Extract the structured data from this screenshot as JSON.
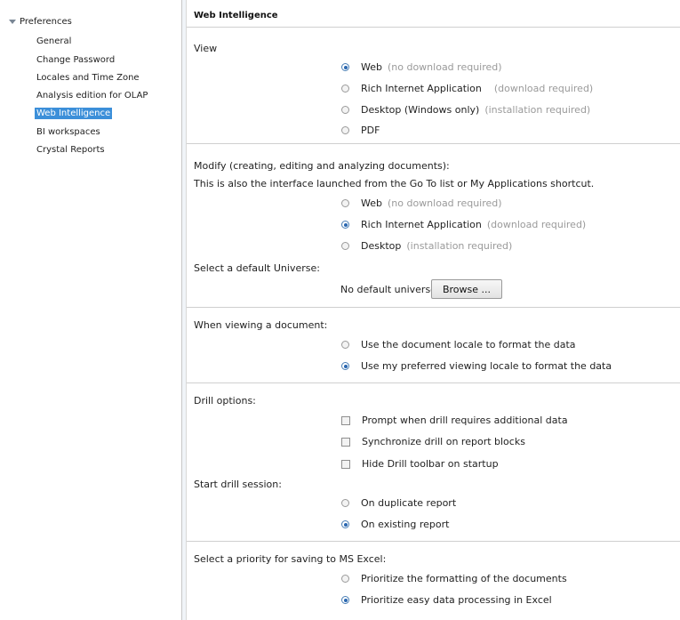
{
  "sidebar": {
    "root_label": "Preferences",
    "items": [
      {
        "label": "General"
      },
      {
        "label": "Change Password"
      },
      {
        "label": "Locales and Time Zone"
      },
      {
        "label": "Analysis edition for OLAP"
      },
      {
        "label": "Web Intelligence",
        "selected": true
      },
      {
        "label": "BI workspaces"
      },
      {
        "label": "Crystal Reports"
      }
    ]
  },
  "main": {
    "title": "Web Intelligence",
    "view": {
      "label": "View",
      "options": [
        {
          "label": "Web",
          "hint": "(no download required)",
          "selected": true
        },
        {
          "label": "Rich Internet Application",
          "hint": "(download required)",
          "selected": false
        },
        {
          "label": "Desktop (Windows only)",
          "hint": "(installation required)",
          "selected": false
        },
        {
          "label": "PDF",
          "hint": "",
          "selected": false
        }
      ]
    },
    "modify": {
      "label_line1": "Modify (creating, editing and analyzing documents):",
      "label_line2": "This is also the interface launched from the Go To list or My Applications shortcut.",
      "options": [
        {
          "label": "Web",
          "hint": "(no download required)",
          "selected": false
        },
        {
          "label": "Rich Internet Application",
          "hint": "(download required)",
          "selected": true
        },
        {
          "label": "Desktop",
          "hint": "(installation required)",
          "selected": false
        }
      ],
      "universe_label": "Select a default Universe:",
      "universe_value": "No default universe",
      "browse_label": "Browse ..."
    },
    "viewing": {
      "label": "When viewing a document:",
      "options": [
        {
          "label": "Use the document locale to format the data",
          "selected": false
        },
        {
          "label": "Use my preferred viewing locale to format the data",
          "selected": true
        }
      ]
    },
    "drill": {
      "label": "Drill options:",
      "checks": [
        {
          "label": "Prompt when drill requires additional data",
          "checked": false
        },
        {
          "label": "Synchronize drill on report blocks",
          "checked": false
        },
        {
          "label": "Hide Drill toolbar on startup",
          "checked": false
        }
      ],
      "session_label": "Start drill session:",
      "session_options": [
        {
          "label": "On duplicate report",
          "selected": false
        },
        {
          "label": "On existing report",
          "selected": true
        }
      ]
    },
    "excel": {
      "label": "Select a priority for saving to MS Excel:",
      "options": [
        {
          "label": "Prioritize the formatting of the documents",
          "selected": false
        },
        {
          "label": "Prioritize easy data processing in Excel",
          "selected": true
        }
      ]
    }
  }
}
